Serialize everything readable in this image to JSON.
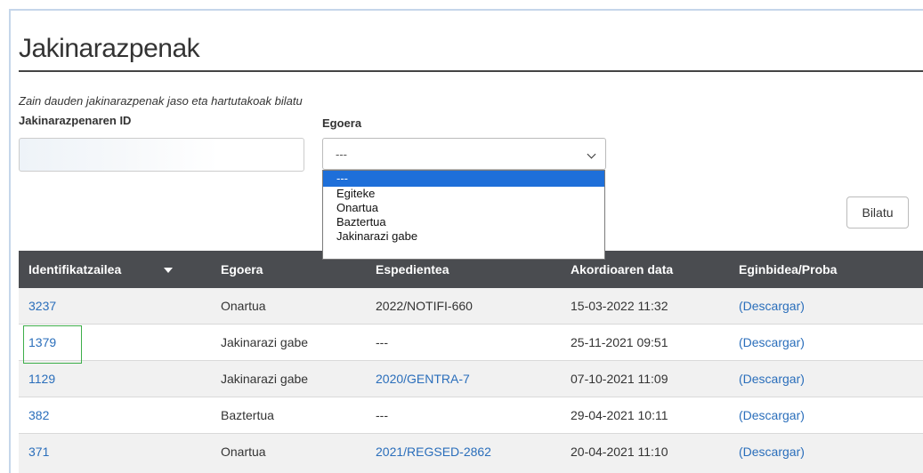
{
  "page": {
    "title": "Jakinarazpenak",
    "subtitle": "Zain dauden jakinarazpenak jaso eta hartutakoak bilatu"
  },
  "filters": {
    "id_label": "Jakinarazpenaren ID",
    "id_value": "",
    "status_label": "Egoera",
    "status_selected": "---",
    "status_options": [
      "---",
      "Egiteke",
      "Onartua",
      "Baztertua",
      "Jakinarazi gabe"
    ],
    "search_button": "Bilatu"
  },
  "table": {
    "columns": [
      "Identifikatzailea",
      "Egoera",
      "Espedientea",
      "Akordioaren data",
      "Eginbidea/Proba"
    ],
    "rows": [
      {
        "id": "3237",
        "status": "Onartua",
        "file": "2022/NOTIFI-660",
        "date": "15-03-2022 11:32",
        "proof": "(Descargar)"
      },
      {
        "id": "1379",
        "status": "Jakinarazi gabe",
        "file": "---",
        "date": "25-11-2021 09:51",
        "proof": "(Descargar)"
      },
      {
        "id": "1129",
        "status": "Jakinarazi gabe",
        "file": "2020/GENTRA-7",
        "date": "07-10-2021 11:09",
        "proof": "(Descargar)"
      },
      {
        "id": "382",
        "status": "Baztertua",
        "file": "---",
        "date": "29-04-2021 10:11",
        "proof": "(Descargar)"
      },
      {
        "id": "371",
        "status": "Onartua",
        "file": "2021/REGSED-2862",
        "date": "20-04-2021 11:10",
        "proof": "(Descargar)"
      }
    ]
  },
  "colors": {
    "header_bg": "#4a4c50",
    "link": "#2a6ebb",
    "selected_option": "#1e6fd9",
    "focus_outline": "#3dae4a"
  }
}
